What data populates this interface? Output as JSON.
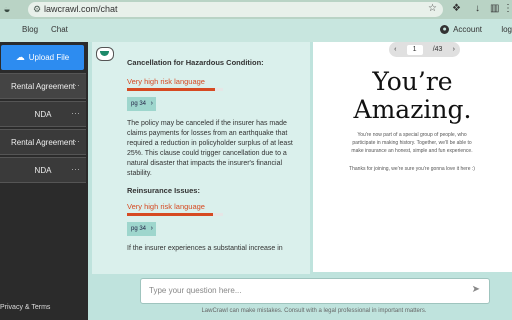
{
  "browser": {
    "url": "lawcrawl.com/chat"
  },
  "nav": {
    "blog": "Blog",
    "chat": "Chat",
    "account": "Account",
    "logout": "log"
  },
  "sidebar": {
    "upload_label": "Upload File",
    "items": [
      {
        "label": "Rental Agreement"
      },
      {
        "label": "NDA"
      },
      {
        "label": "Rental Agreement"
      },
      {
        "label": "NDA"
      }
    ],
    "privacy": "Privacy & Terms"
  },
  "chat": {
    "messages": [
      {
        "heading": "Cancellation for Hazardous Condition:",
        "risk_label": "Very high risk language",
        "risk_level": 0.92,
        "page_ref": "pg 34",
        "body": "The policy may be canceled if the insurer has made claims payments for losses from an earthquake that required a reduction in policyholder surplus of at least 25%. This clause could trigger cancellation due to a natural disaster that impacts the insurer's financial stability."
      },
      {
        "heading": "Reinsurance Issues:",
        "risk_label": "Very high risk language",
        "risk_level": 0.9,
        "page_ref": "pg 34",
        "body": "If the insurer experiences a substantial increase in"
      }
    ]
  },
  "viewer": {
    "page": "1",
    "total": "/43",
    "title_line1": "You’re",
    "title_line2": "Amazing.",
    "para1": "You’re now part of a special group of people, who participate in making history. Together, we’ll be able to make insurance an honest, simple and fun experience.",
    "para2": "Thanks for joining, we’re sure you’re gonna love it here :)"
  },
  "input": {
    "placeholder": "Type your question here..."
  },
  "footer": "LawCrawl can make mistakes. Consult with a legal professional in important matters.",
  "colors": {
    "accent": "#2d8cf0",
    "risk": "#d64a22",
    "chat_bg": "#daf0ec"
  }
}
